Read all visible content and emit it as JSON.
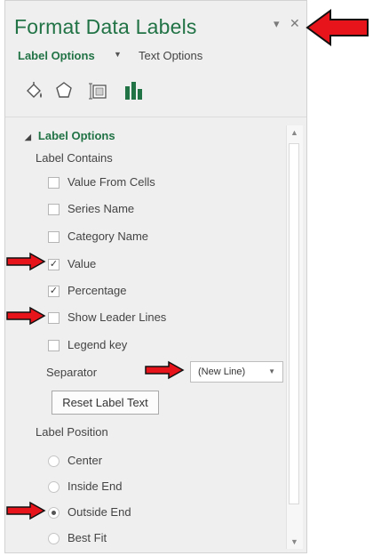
{
  "pane": {
    "title": "Format Data Labels",
    "dropdown_glyph": "▾",
    "close_glyph": "✕",
    "tabs": [
      {
        "label": "Label Options",
        "caret": "▼"
      },
      {
        "label": "Text Options"
      }
    ],
    "icon_tabs": [
      "fill-line-icon",
      "effects-icon",
      "size-properties-icon",
      "label-options-icon"
    ]
  },
  "section": {
    "title": "Label Options",
    "collapse_glyph": "◢",
    "label_contains_heading": "Label Contains",
    "checkboxes": [
      {
        "label": "Value From Cells",
        "checked": false
      },
      {
        "label": "Series Name",
        "checked": false
      },
      {
        "label": "Category Name",
        "checked": false
      },
      {
        "label": "Value",
        "checked": true
      },
      {
        "label": "Percentage",
        "checked": true
      },
      {
        "label": "Show Leader Lines",
        "checked": false
      },
      {
        "label": "Legend key",
        "checked": false
      }
    ],
    "separator": {
      "label": "Separator",
      "value": "(New Line)",
      "arrow": "▼"
    },
    "reset_button": "Reset Label Text",
    "position_heading": "Label Position",
    "positions": [
      {
        "label": "Center",
        "selected": false
      },
      {
        "label": "Inside End",
        "selected": false
      },
      {
        "label": "Outside End",
        "selected": true
      },
      {
        "label": "Best Fit",
        "selected": false
      }
    ]
  },
  "scrollbar": {
    "up": "▲",
    "down": "▼"
  },
  "colors": {
    "accent": "#217346",
    "annotation_arrow": "#e8141b"
  }
}
